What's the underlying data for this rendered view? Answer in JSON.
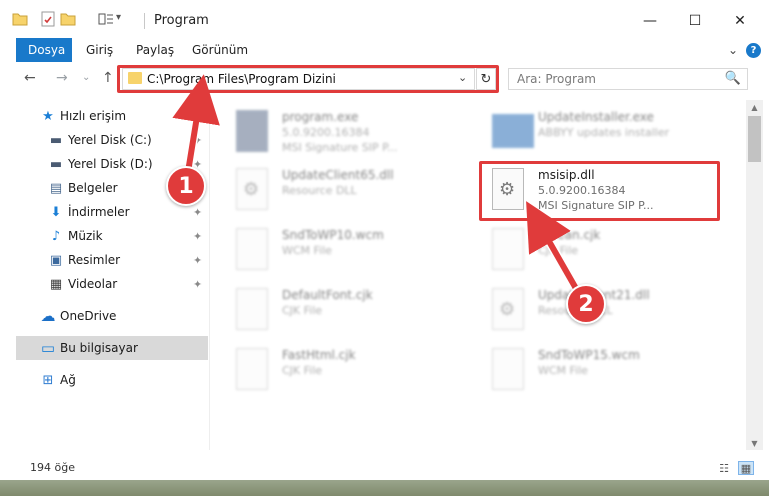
{
  "window": {
    "title": "Program",
    "controls": {
      "minimize": "—",
      "maximize": "☐",
      "close": "✕"
    }
  },
  "ribbon": {
    "tabs": [
      "Dosya",
      "Giriş",
      "Paylaş",
      "Görünüm"
    ],
    "active_tab": "Dosya",
    "chevron": "⌄",
    "help": "?"
  },
  "navigation": {
    "back": "←",
    "forward": "→",
    "recent": "⌄",
    "up": "↑",
    "address": "C:\\Program Files\\Program Dizini",
    "address_dropdown": "⌄",
    "refresh": "↻",
    "search_placeholder": "Ara: Program",
    "search_icon": "🔍"
  },
  "sidebar": {
    "items": [
      {
        "label": "Hızlı erişim",
        "icon": "star-icon",
        "glyph": "★",
        "color": "#1b7fd6",
        "pinned": false
      },
      {
        "label": "Yerel Disk (C:)",
        "icon": "drive-icon",
        "glyph": "▬",
        "color": "#4a5b72",
        "pinned": true
      },
      {
        "label": "Yerel Disk (D:)",
        "icon": "drive-icon",
        "glyph": "▬",
        "color": "#4a5b72",
        "pinned": true
      },
      {
        "label": "Belgeler",
        "icon": "documents-icon",
        "glyph": "▤",
        "color": "#4a6a90",
        "pinned": true
      },
      {
        "label": "İndirmeler",
        "icon": "download-icon",
        "glyph": "⬇",
        "color": "#1b7fd6",
        "pinned": true
      },
      {
        "label": "Müzik",
        "icon": "music-icon",
        "glyph": "♪",
        "color": "#1b7fd6",
        "pinned": true
      },
      {
        "label": "Resimler",
        "icon": "pictures-icon",
        "glyph": "▣",
        "color": "#3c6a9e",
        "pinned": true
      },
      {
        "label": "Videolar",
        "icon": "videos-icon",
        "glyph": "▦",
        "color": "#3a3a3a",
        "pinned": true
      },
      {
        "label": "OneDrive",
        "icon": "cloud-icon",
        "glyph": "☁",
        "color": "#1b6fc7",
        "pinned": false
      },
      {
        "label": "Bu bilgisayar",
        "icon": "computer-icon",
        "glyph": "▭",
        "color": "#1b7fd6",
        "pinned": false,
        "selected": true
      },
      {
        "label": "Ağ",
        "icon": "network-icon",
        "glyph": "⊞",
        "color": "#2d7bd0",
        "pinned": false
      }
    ],
    "pin_glyph": "📌"
  },
  "files": [
    {
      "name": "program.exe",
      "line2": "5.0.9200.16384",
      "line3": "MSI Signature SIP P...",
      "icon": "exe",
      "blurred": true
    },
    {
      "name": "UpdateInstaller.exe",
      "line2": "ABBYY updates installer",
      "line3": "",
      "icon": "installer",
      "blurred": true
    },
    {
      "name": "UpdateClient65.dll",
      "line2": "Resource DLL",
      "line3": "",
      "icon": "gear",
      "blurred": true
    },
    {
      "name": "msisip.dll",
      "line2": "5.0.9200.16384",
      "line3": "MSI Signature SIP P...",
      "icon": "gear",
      "blurred": false
    },
    {
      "name": "SndToWP10.wcm",
      "line2": "WCM File",
      "line3": "",
      "icon": "doc",
      "blurred": true
    },
    {
      "name": "Korean.cjk",
      "line2": "CJK File",
      "line3": "",
      "icon": "doc",
      "blurred": true
    },
    {
      "name": "DefaultFont.cjk",
      "line2": "CJK File",
      "line3": "",
      "icon": "doc",
      "blurred": true
    },
    {
      "name": "UpdateClient21.dll",
      "line2": "Resource DLL",
      "line3": "",
      "icon": "gear",
      "blurred": true
    },
    {
      "name": "FastHtml.cjk",
      "line2": "CJK File",
      "line3": "",
      "icon": "doc",
      "blurred": true
    },
    {
      "name": "SndToWP15.wcm",
      "line2": "WCM File",
      "line3": "",
      "icon": "doc",
      "blurred": true
    }
  ],
  "status": {
    "item_count": "194 öğe",
    "details_view": "☷",
    "tiles_view": "▦"
  },
  "callouts": [
    {
      "number": "1"
    },
    {
      "number": "2"
    }
  ],
  "colors": {
    "accent": "#1979ca",
    "highlight_red": "#e03b3b",
    "folder_yellow": "#f7d36b"
  }
}
